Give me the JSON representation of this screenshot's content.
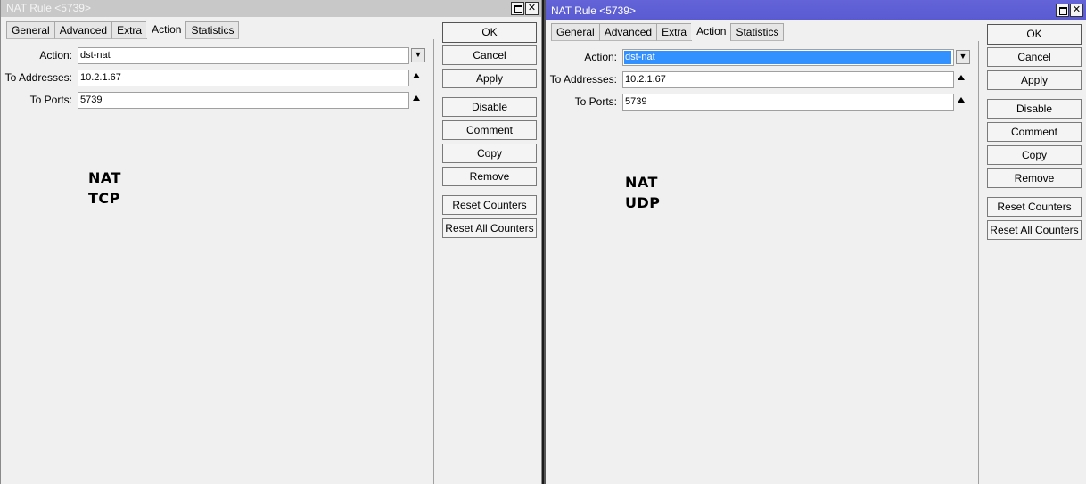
{
  "left": {
    "title": "NAT Rule <5739>",
    "tabs": [
      "General",
      "Advanced",
      "Extra",
      "Action",
      "Statistics"
    ],
    "active_tab": "Action",
    "fields": {
      "action_label": "Action:",
      "action_value": "dst-nat",
      "to_addresses_label": "To Addresses:",
      "to_addresses_value": "10.2.1.67",
      "to_ports_label": "To Ports:",
      "to_ports_value": "5739"
    },
    "note_line1": "NAT",
    "note_line2": "TCP",
    "buttons": {
      "ok": "OK",
      "cancel": "Cancel",
      "apply": "Apply",
      "disable": "Disable",
      "comment": "Comment",
      "copy": "Copy",
      "remove": "Remove",
      "reset_counters": "Reset Counters",
      "reset_all_counters": "Reset All Counters"
    }
  },
  "right": {
    "title": "NAT Rule <5739>",
    "tabs": [
      "General",
      "Advanced",
      "Extra",
      "Action",
      "Statistics"
    ],
    "active_tab": "Action",
    "fields": {
      "action_label": "Action:",
      "action_value": "dst-nat",
      "to_addresses_label": "To Addresses:",
      "to_addresses_value": "10.2.1.67",
      "to_ports_label": "To Ports:",
      "to_ports_value": "5739"
    },
    "note_line1": "NAT",
    "note_line2": "UDP",
    "buttons": {
      "ok": "OK",
      "cancel": "Cancel",
      "apply": "Apply",
      "disable": "Disable",
      "comment": "Comment",
      "copy": "Copy",
      "remove": "Remove",
      "reset_counters": "Reset Counters",
      "reset_all_counters": "Reset All Counters"
    }
  },
  "colors": {
    "active_titlebar": "#5a5ad2",
    "inactive_titlebar": "#c8c8c8",
    "selection": "#3390ff"
  }
}
